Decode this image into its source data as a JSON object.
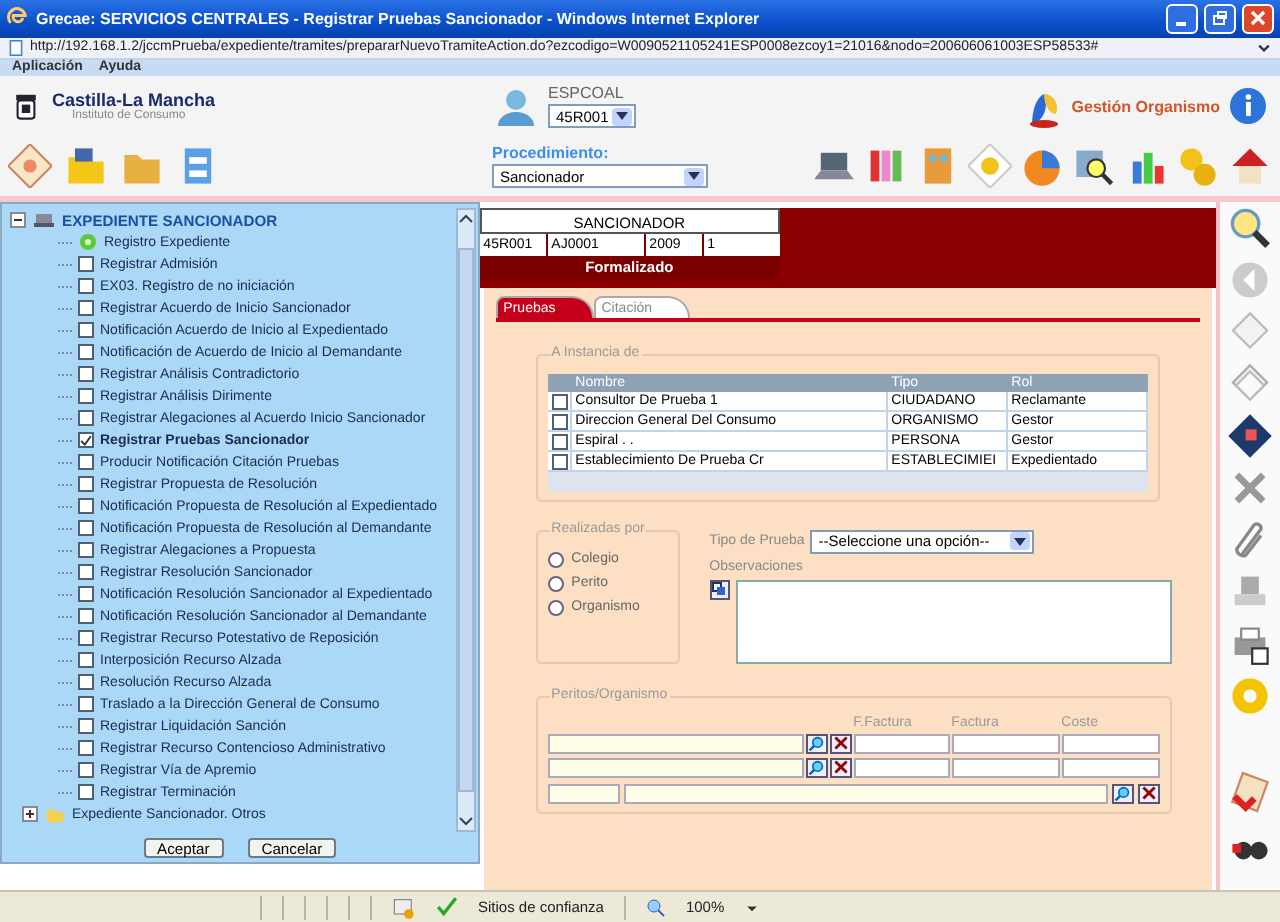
{
  "window": {
    "title": "Grecae: SERVICIOS CENTRALES - Registrar Pruebas Sancionador - Windows Internet Explorer"
  },
  "address_bar": {
    "url": "http://192.168.1.2/jccmPrueba/expediente/tramites/prepararNuevoTramiteAction.do?ezcodigo=W0090521105241ESP0008ezcoy1=21016&nodo=200606061003ESP58533#"
  },
  "menu": [
    "Aplicación",
    "Ayuda"
  ],
  "header": {
    "logo_title": "Castilla-La Mancha",
    "logo_subtitle": "Instituto de Consumo",
    "user": "ESPCOAL",
    "office": "45R001",
    "organism": "Gestión Organismo"
  },
  "toolbar": {
    "procedure_label": "Procedimiento:",
    "procedure": "Sancionador"
  },
  "tree": [
    {
      "label": "EXPEDIENTE SANCIONADOR",
      "kind": "root",
      "expanded": true,
      "children": [
        {
          "label": "Registro Expediente",
          "kind": "done"
        },
        {
          "label": "Registrar Admisión",
          "kind": "task",
          "checked": false
        },
        {
          "label": "EX03. Registro de no iniciación",
          "kind": "task",
          "checked": false
        },
        {
          "label": "Registrar Acuerdo de Inicio Sancionador",
          "kind": "task",
          "checked": false
        },
        {
          "label": "Notificación Acuerdo de Inicio al Expedientado",
          "kind": "task",
          "checked": false
        },
        {
          "label": "Notificación de Acuerdo de Inicio al Demandante",
          "kind": "task",
          "checked": false
        },
        {
          "label": "Registrar Análisis Contradictorio",
          "kind": "task",
          "checked": false
        },
        {
          "label": "Registrar Análisis Dirimente",
          "kind": "task",
          "checked": false
        },
        {
          "label": "Registrar Alegaciones al Acuerdo Inicio Sancionador",
          "kind": "task",
          "checked": false
        },
        {
          "label": "Registrar Pruebas Sancionador",
          "kind": "task",
          "checked": true
        },
        {
          "label": "Producir Notificación Citación Pruebas",
          "kind": "task",
          "checked": false
        },
        {
          "label": "Registrar Propuesta de Resolución",
          "kind": "task",
          "checked": false
        },
        {
          "label": "Notificación Propuesta de Resolución al Expedientado",
          "kind": "task",
          "checked": false
        },
        {
          "label": "Notificación Propuesta de Resolución al Demandante",
          "kind": "task",
          "checked": false
        },
        {
          "label": "Registrar Alegaciones a Propuesta",
          "kind": "task",
          "checked": false
        },
        {
          "label": "Registrar Resolución Sancionador",
          "kind": "task",
          "checked": false
        },
        {
          "label": "Notificación Resolución Sancionador al Expedientado",
          "kind": "task",
          "checked": false
        },
        {
          "label": "Notificación Resolución Sancionador al Demandante",
          "kind": "task",
          "checked": false
        },
        {
          "label": "Registrar Recurso Potestativo de Reposición",
          "kind": "task",
          "checked": false
        },
        {
          "label": "Interposición Recurso Alzada",
          "kind": "task",
          "checked": false
        },
        {
          "label": "Resolución Recurso Alzada",
          "kind": "task",
          "checked": false
        },
        {
          "label": "Traslado a la Dirección General de Consumo",
          "kind": "task",
          "checked": false
        },
        {
          "label": "Registrar Liquidación Sanción",
          "kind": "task",
          "checked": false
        },
        {
          "label": "Registrar Recurso Contencioso Administrativo",
          "kind": "task",
          "checked": false
        },
        {
          "label": "Registrar Vía de Apremio",
          "kind": "task",
          "checked": false
        },
        {
          "label": "Registrar Terminación",
          "kind": "task",
          "checked": false
        }
      ]
    },
    {
      "label": "Expediente Sancionador. Otros",
      "kind": "folder",
      "expanded": false
    }
  ],
  "popup_buttons": [
    "Aceptar",
    "Cancelar"
  ],
  "record": {
    "procedure": "SANCIONADOR",
    "fields": [
      "45R001",
      "AJ0001",
      "2009",
      "1"
    ],
    "status": "Formalizado"
  },
  "tabs": [
    {
      "label": "Pruebas",
      "selected": true
    },
    {
      "label": "Citación",
      "selected": false
    }
  ],
  "instancia": {
    "legend": "A Instancia de",
    "columns": [
      "Nombre",
      "Tipo",
      "Rol"
    ],
    "rows": [
      {
        "checked": false,
        "cells": [
          "Consultor De Prueba 1",
          "CIUDADANO",
          "Reclamante"
        ]
      },
      {
        "checked": false,
        "cells": [
          "Direccion General Del Consumo",
          "ORGANISMO",
          "Gestor"
        ]
      },
      {
        "checked": false,
        "cells": [
          "Espiral . .",
          "PERSONA",
          "Gestor"
        ]
      },
      {
        "checked": false,
        "cells": [
          "Establecimiento De Prueba Cr",
          "ESTABLECIMIEI",
          "Expedientado"
        ]
      }
    ]
  },
  "realizadas": {
    "legend": "Realizadas por",
    "options": [
      {
        "label": "Colegio",
        "selected": false
      },
      {
        "label": "Perito",
        "selected": false
      },
      {
        "label": "Organismo",
        "selected": false
      }
    ]
  },
  "tipo_prueba": {
    "label": "Tipo de Prueba",
    "value": "--Seleccione una opción--"
  },
  "observaciones": {
    "label": "Observaciones"
  },
  "peritos": {
    "legend": "Peritos/Organismo",
    "columns": [
      "F.Factura",
      "Factura",
      "Coste"
    ]
  },
  "status_bar": {
    "zone": "Sitios de confianza",
    "zoom": "100%"
  }
}
